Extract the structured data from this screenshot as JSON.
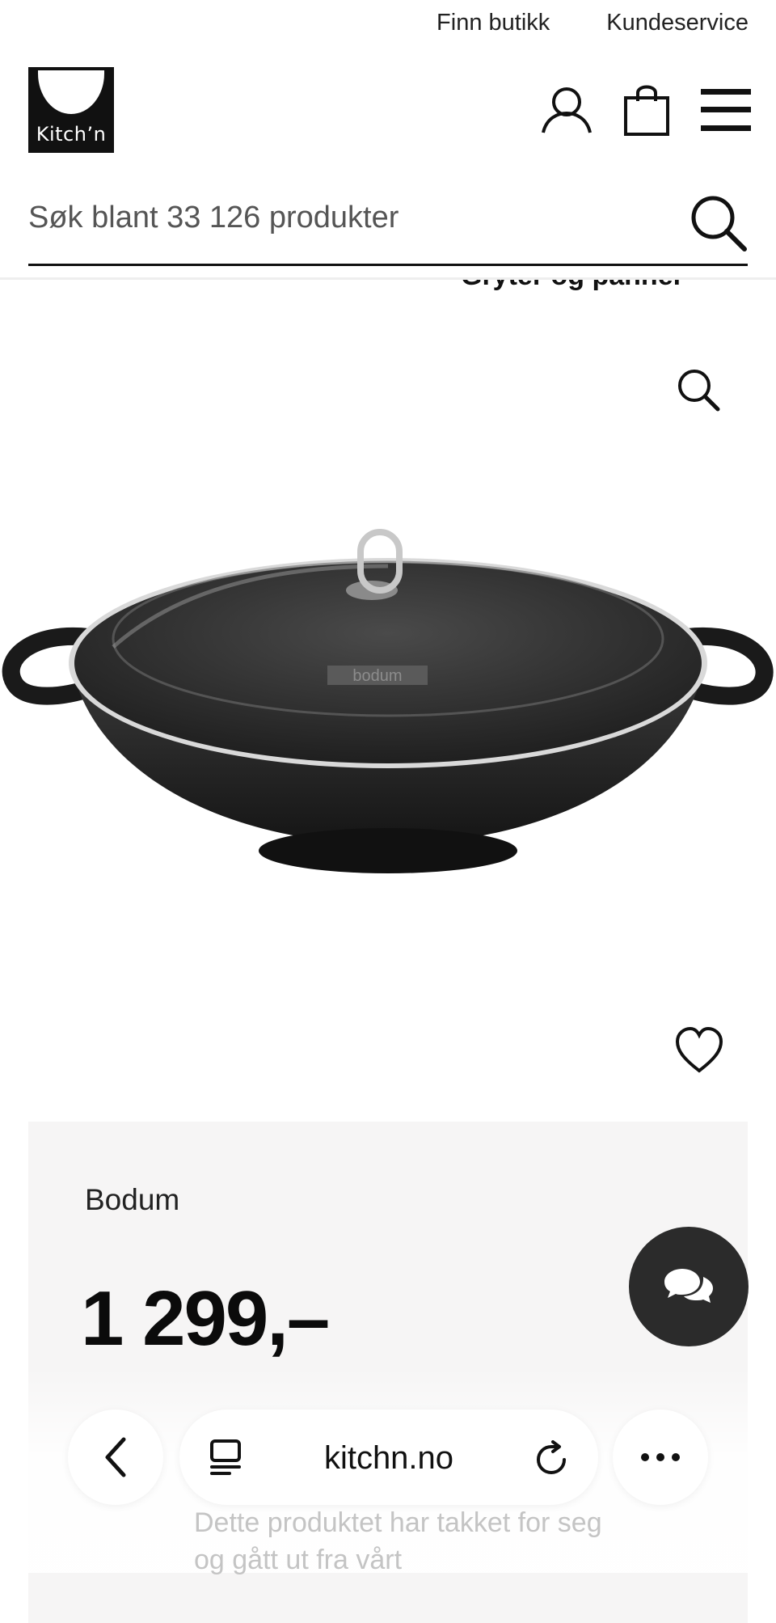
{
  "top_links": {
    "find_store": "Finn butikk",
    "customer_service": "Kundeservice"
  },
  "logo": {
    "text": "Kitch’n"
  },
  "header_icons": [
    "user-icon",
    "shopping-bag-icon",
    "hamburger-menu-icon"
  ],
  "search": {
    "placeholder": "Søk blant 33 126 produkter"
  },
  "breadcrumb": {
    "current": "Gryter og panner"
  },
  "product": {
    "brand": "Bodum",
    "lid_brand_mark": "bodum",
    "price": "1 299,–"
  },
  "browser": {
    "url": "kitchn.no"
  },
  "notice": "Dette produktet har takket for seg og gått ut fra vårt",
  "colors": {
    "text": "#111111",
    "panel_bg": "#f6f5f5",
    "chat_bg": "#2b2b2b"
  }
}
